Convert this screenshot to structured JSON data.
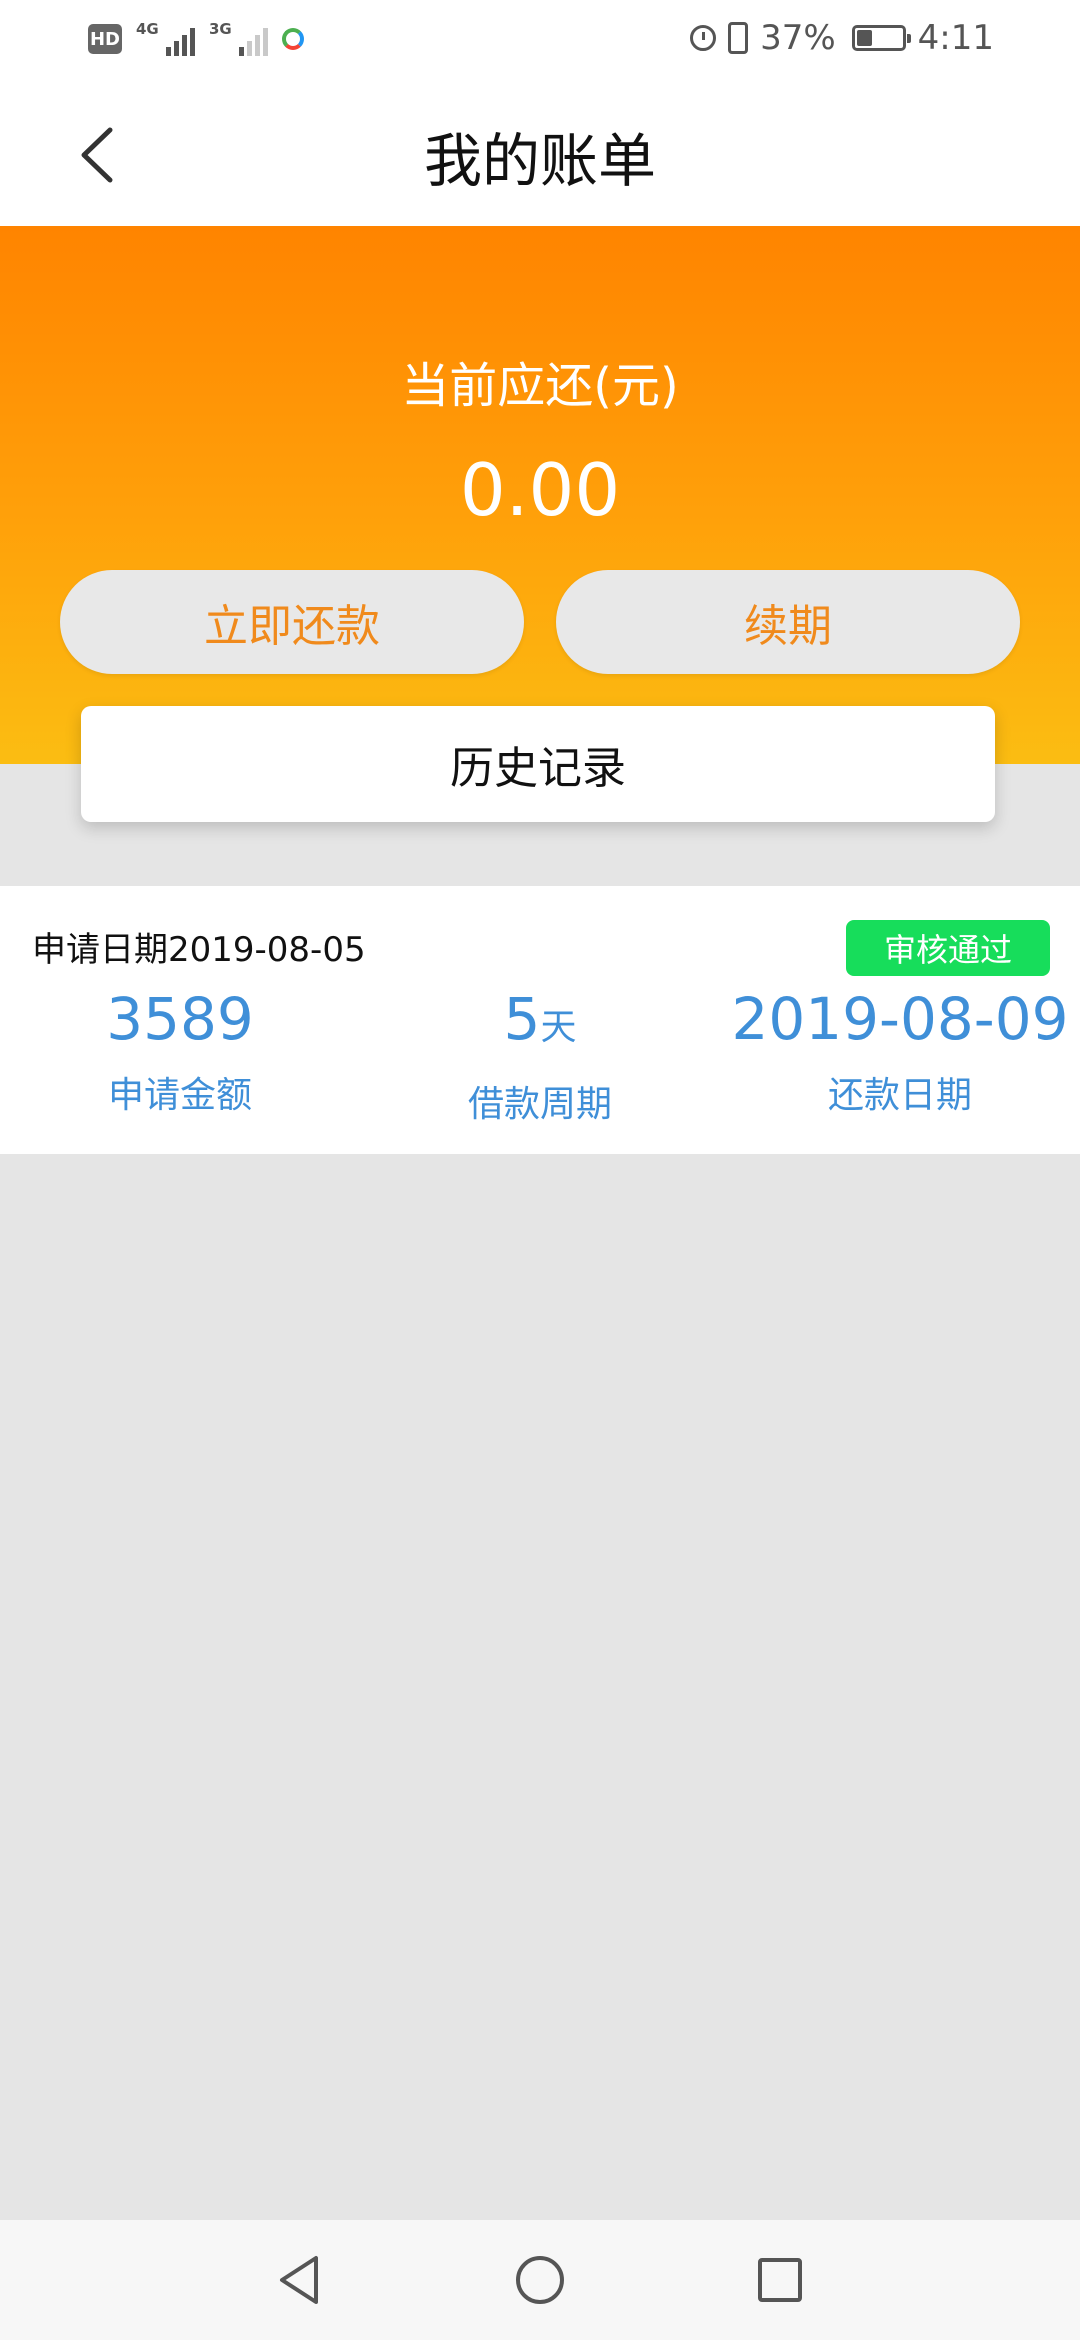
{
  "status_bar": {
    "network_1": "4G",
    "network_2": "3G",
    "battery": "37%",
    "battery_level_percent": 37,
    "time": "4:11"
  },
  "header": {
    "title": "我的账单"
  },
  "summary": {
    "due_label": "当前应还(元)",
    "due_amount": "0.00",
    "repay_button": "立即还款",
    "renew_button": "续期",
    "history_button": "历史记录"
  },
  "bill": {
    "apply_date_label": "申请日期",
    "apply_date": "2019-08-05",
    "status": "审核通过",
    "amount": "3589",
    "amount_label": "申请金额",
    "period": "5",
    "period_unit": "天",
    "period_label": "借款周期",
    "repay_date": "2019-08-09",
    "repay_date_label": "还款日期"
  },
  "colors": {
    "accent_orange": "#ff8400",
    "button_text": "#f08a1c",
    "stat_blue": "#3f8fd8",
    "status_green": "#17dd5b"
  }
}
